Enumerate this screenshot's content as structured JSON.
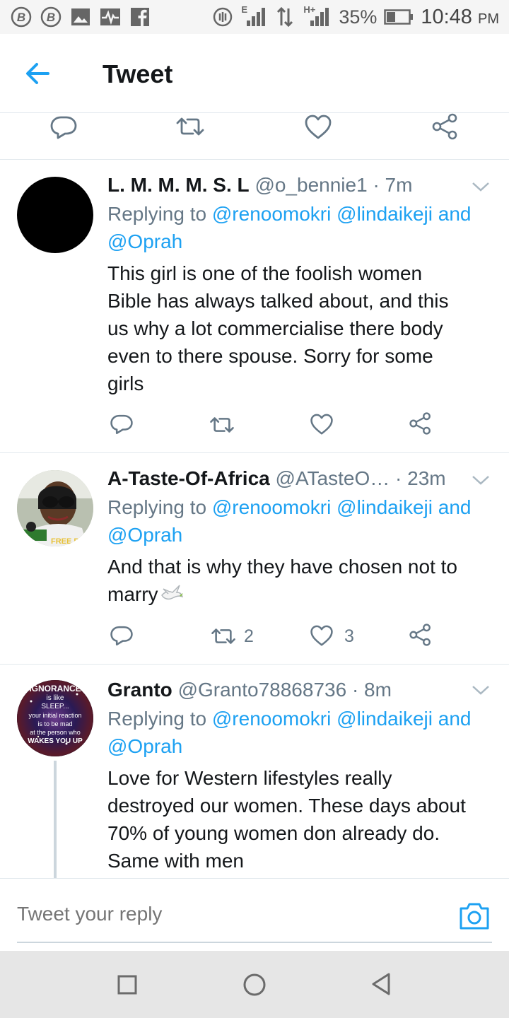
{
  "status_bar": {
    "battery": "35%",
    "time": "10:48",
    "ampm": "PM",
    "icons": [
      "b-icon",
      "b-icon",
      "image-icon",
      "pulse-icon",
      "facebook-icon",
      "data-saver-icon",
      "signal-icon",
      "data-transfer-icon",
      "signal-icon",
      "battery-icon"
    ],
    "net_e": "E",
    "net_h": "H+"
  },
  "header": {
    "title": "Tweet"
  },
  "tweets": [
    {
      "name": "L. M. M. M. S. L",
      "handle": "@o_bennie1",
      "time": "· 7m",
      "replying_prefix": "Replying to ",
      "mention1": "@renoomokri",
      "mention2": "@lindaikeji",
      "and": " and",
      "mention3": "@Oprah",
      "text_lines": [
        "This girl is one of the foolish women",
        "Bible has always talked about, and this",
        "us why a lot commercialise there body",
        "even to there spouse. Sorry for some",
        "girls"
      ],
      "retweets": "",
      "likes": ""
    },
    {
      "name": "A-Taste-Of-Africa",
      "handle": "@ATasteO…",
      "time": " · 23m",
      "replying_prefix": "Replying to ",
      "mention1": "@renoomokri",
      "mention2": "@lindaikeji",
      "and": " and",
      "mention3": "@Oprah",
      "text_lines": [
        "And that is why they have chosen not to",
        "marry"
      ],
      "avatar_badge": "FREE BI",
      "retweets": "2",
      "likes": "3"
    },
    {
      "name": "Granto",
      "handle": "@Granto78868736",
      "time": "· 8m",
      "replying_prefix": "Replying to ",
      "mention1": "@renoomokri",
      "mention2": "@lindaikeji",
      "and": " and",
      "mention3": "@Oprah",
      "text_lines": [
        "Love for Western lifestyles really",
        "destroyed our women. These days about",
        "70% of young women don already do.",
        "Same with men"
      ],
      "avatar_text": [
        "IGNORANCE",
        "is like",
        "SLEEP...",
        "your initial reaction",
        "is to be mad",
        "at the person who",
        "WAKES YOU UP"
      ]
    }
  ],
  "composer": {
    "placeholder": "Tweet your reply"
  },
  "colors": {
    "accent": "#1da1f2",
    "text": "#14171a",
    "secondary": "#657786",
    "divider": "#e1e8ed"
  }
}
